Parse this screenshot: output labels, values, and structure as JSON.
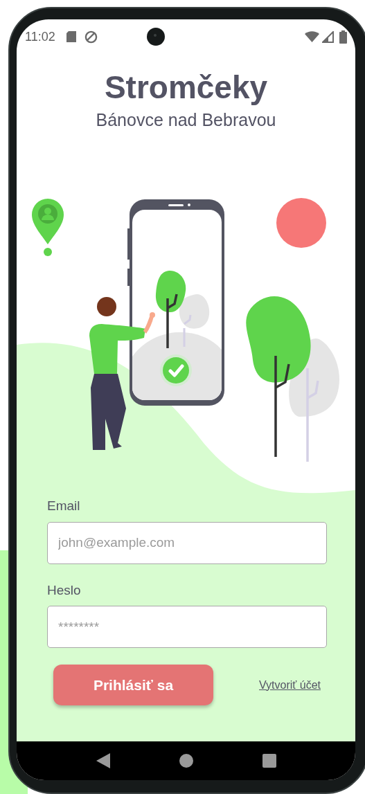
{
  "status_bar": {
    "time": "11:02"
  },
  "header": {
    "title": "Stromčeky",
    "subtitle": "Bánovce nad Bebravou"
  },
  "form": {
    "fields": [
      {
        "label": "Email",
        "placeholder": "john@example.com"
      },
      {
        "label": "Heslo",
        "placeholder": "********"
      }
    ],
    "login_button": "Prihlásiť sa",
    "create_account_link": "Vytvoriť účet"
  }
}
